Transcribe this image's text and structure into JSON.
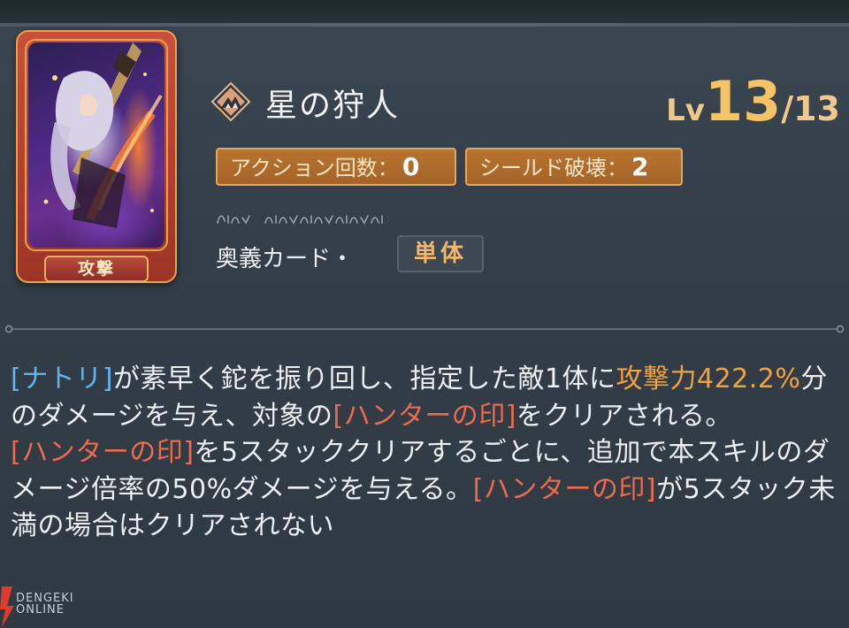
{
  "card": {
    "label": "攻撃"
  },
  "skill": {
    "name": "星の狩人",
    "level_prefix": "Lv",
    "level_current": "13",
    "level_max": "/13",
    "stats": [
      {
        "label": "アクション回数：",
        "value": "0"
      },
      {
        "label": "シールド破壊：",
        "value": "2"
      }
    ],
    "card_type_label": "奥義カード・",
    "target_tag": "単体"
  },
  "description": {
    "segments": [
      {
        "text": "[ナトリ]",
        "color": "blue"
      },
      {
        "text": "が素早く鉈を振り回し、指定した敵1体に",
        "color": "white"
      },
      {
        "text": "攻撃力422.2%",
        "color": "orange"
      },
      {
        "text": "分のダメージを与え、対象の",
        "color": "white"
      },
      {
        "text": "[ハンターの印]",
        "color": "red"
      },
      {
        "text": "をクリアされる。",
        "color": "white"
      },
      {
        "text": "[ハンターの印]",
        "color": "red"
      },
      {
        "text": "を5スタッククリアするごとに、追加で本スキルのダメージ倍率の50%ダメージを与える。",
        "color": "white"
      },
      {
        "text": "[ハンターの印]",
        "color": "red"
      },
      {
        "text": "が5スタック未満の場合はクリアされない",
        "color": "white"
      }
    ]
  },
  "watermark": {
    "line1": "DENGEKI",
    "line2": "ONLINE"
  },
  "colors": {
    "blue_keyword": "#62b4ee",
    "orange_keyword": "#f2a23c",
    "red_keyword": "#ee6a4e",
    "tag_bg": "#b8742c",
    "level_gold": "#f5c466"
  },
  "icons": {
    "skill_icon": "mountain-diamond-icon",
    "divider": "ornament-divider"
  }
}
